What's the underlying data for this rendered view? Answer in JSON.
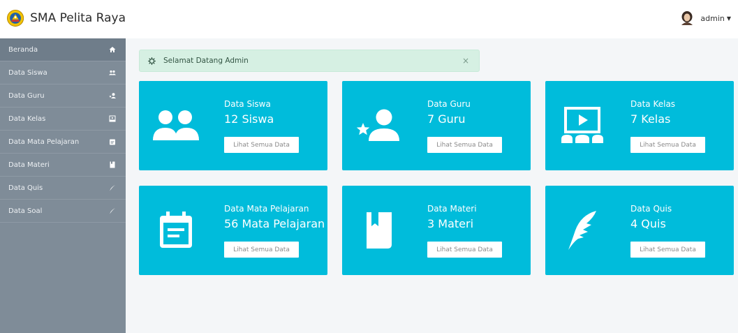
{
  "app": {
    "title": "SMA Pelita Raya"
  },
  "user": {
    "name": "admin"
  },
  "sidebar": {
    "items": [
      {
        "label": "Beranda",
        "icon": "home-icon"
      },
      {
        "label": "Data Siswa",
        "icon": "users-icon"
      },
      {
        "label": "Data Guru",
        "icon": "teacher-icon"
      },
      {
        "label": "Data Kelas",
        "icon": "classroom-icon"
      },
      {
        "label": "Data Mata Pelajaran",
        "icon": "calendar-icon"
      },
      {
        "label": "Data Materi",
        "icon": "book-icon"
      },
      {
        "label": "Data Quis",
        "icon": "pencil-icon"
      },
      {
        "label": "Data Soal",
        "icon": "pencil-icon"
      }
    ]
  },
  "alert": {
    "text": "Selamat Datang Admin",
    "close": "×"
  },
  "cards": [
    {
      "title": "Data Siswa",
      "count": "12 Siswa",
      "button": "Lihat Semua Data",
      "icon": "users-icon"
    },
    {
      "title": "Data Guru",
      "count": "7 Guru",
      "button": "Lihat Semua Data",
      "icon": "teacher-icon"
    },
    {
      "title": "Data Kelas",
      "count": "7 Kelas",
      "button": "Lihat Semua Data",
      "icon": "classroom-icon"
    },
    {
      "title": "Data Mata Pelajaran",
      "count": "56 Mata Pelajaran",
      "button": "Lihat Semua Data",
      "icon": "calendar-icon"
    },
    {
      "title": "Data Materi",
      "count": "3 Materi",
      "button": "Lihat Semua Data",
      "icon": "book-icon"
    },
    {
      "title": "Data Quis",
      "count": "4 Quis",
      "button": "Lihat Semua Data",
      "icon": "feather-icon"
    }
  ],
  "colors": {
    "card": "#00bcdb",
    "sidebar": "#7f8c98",
    "sidebar_active": "#6f7d8a",
    "alert_bg": "#d6f0e3",
    "background": "#f4f6f8"
  }
}
